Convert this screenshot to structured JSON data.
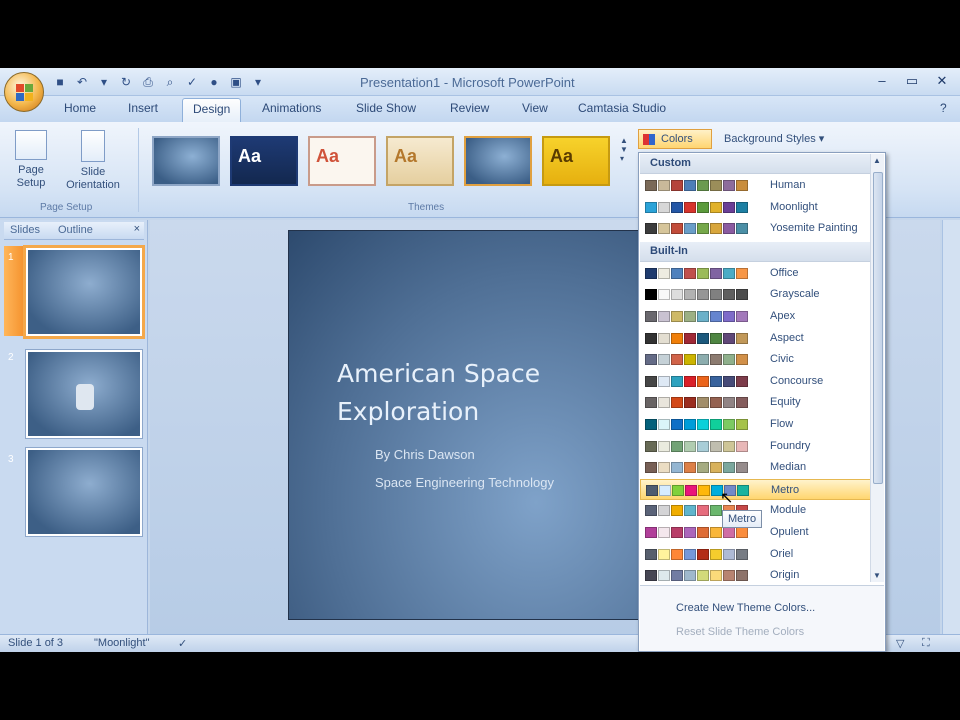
{
  "window": {
    "title": "Presentation1 - Microsoft PowerPoint",
    "controls": [
      "–",
      "▭",
      "✕"
    ]
  },
  "tabs": [
    "Home",
    "Insert",
    "Design",
    "Animations",
    "Slide Show",
    "Review",
    "View",
    "Camtasia Studio"
  ],
  "active_tab": "Design",
  "ribbon": {
    "page_setup": {
      "button1": "Page Setup",
      "button2": "Slide Orientation",
      "group": "Page Setup"
    },
    "themes": {
      "group": "Themes",
      "sample": "Aa"
    },
    "colors_button": "Colors",
    "background_styles": "Background Styles"
  },
  "slides_pane": {
    "tabs": [
      "Slides",
      "Outline"
    ],
    "numbers": [
      "1",
      "2",
      "3"
    ]
  },
  "slide": {
    "title_line1": "American Space",
    "title_line2": "Exploration",
    "subtitle1": "By Chris Dawson",
    "subtitle2": "Space Engineering Technology"
  },
  "statusbar": {
    "slide_info": "Slide 1 of 3",
    "theme": "\"Moonlight\""
  },
  "colors_menu": {
    "custom_header": "Custom",
    "builtin_header": "Built-In",
    "custom": [
      {
        "name": "Human",
        "colors": [
          "#7b6a58",
          "#c9b99a",
          "#b5443b",
          "#4d7eb8",
          "#6a9a4f",
          "#9b8e5a",
          "#8d6c9c",
          "#c98d3c"
        ]
      },
      {
        "name": "Moonlight",
        "colors": [
          "#2ba3d8",
          "#d7d7d7",
          "#2457a6",
          "#d6342c",
          "#5b9a3b",
          "#e1b22a",
          "#6a3f96",
          "#1d7fa3"
        ]
      },
      {
        "name": "Yosemite Painting",
        "colors": [
          "#3c3c3c",
          "#d6c59a",
          "#c24c3a",
          "#6a9ec8",
          "#76a84a",
          "#d8a63c",
          "#8a5ba0",
          "#4b8fa6"
        ]
      }
    ],
    "builtin": [
      {
        "name": "Office",
        "colors": [
          "#1f3b6e",
          "#eeece1",
          "#4f81bd",
          "#c0504d",
          "#9bbb59",
          "#8064a2",
          "#4bacc6",
          "#f79646"
        ]
      },
      {
        "name": "Grayscale",
        "colors": [
          "#000000",
          "#f8f8f8",
          "#dddddd",
          "#b2b2b2",
          "#969696",
          "#808080",
          "#5f5f5f",
          "#4d4d4d"
        ]
      },
      {
        "name": "Apex",
        "colors": [
          "#69676d",
          "#c9c2d1",
          "#ceb966",
          "#9cb084",
          "#6bb1c9",
          "#6585cf",
          "#7e6bc9",
          "#a379bb"
        ]
      },
      {
        "name": "Aspect",
        "colors": [
          "#323232",
          "#e3ded1",
          "#f07f09",
          "#9f2936",
          "#1b587c",
          "#4e8542",
          "#604878",
          "#c19859"
        ]
      },
      {
        "name": "Civic",
        "colors": [
          "#646b86",
          "#c5d1d7",
          "#d16349",
          "#ccb400",
          "#8cadae",
          "#8c7b70",
          "#8fb08c",
          "#d19049"
        ]
      },
      {
        "name": "Concourse",
        "colors": [
          "#464646",
          "#dee9f5",
          "#2da2bf",
          "#da1f28",
          "#eb641b",
          "#39639d",
          "#474b78",
          "#7d3c4a"
        ]
      },
      {
        "name": "Equity",
        "colors": [
          "#696464",
          "#e9e5dc",
          "#d34817",
          "#9b2d1f",
          "#a28e6a",
          "#956251",
          "#918485",
          "#855d5d"
        ]
      },
      {
        "name": "Flow",
        "colors": [
          "#04617b",
          "#dbf5f9",
          "#0f6fc6",
          "#009dd9",
          "#0bd0d9",
          "#10cf9b",
          "#7cca62",
          "#a5c249"
        ]
      },
      {
        "name": "Foundry",
        "colors": [
          "#676a55",
          "#eaebde",
          "#72a376",
          "#b0ccb0",
          "#a8cdd7",
          "#c0beaf",
          "#cec597",
          "#e8b7b7"
        ]
      },
      {
        "name": "Median",
        "colors": [
          "#775f55",
          "#ebddc3",
          "#94b6d2",
          "#dd8047",
          "#a5ab81",
          "#d8b25c",
          "#7ba79d",
          "#968c8c"
        ]
      },
      {
        "name": "Metro",
        "colors": [
          "#4e5b6f",
          "#d6ecff",
          "#7fd13b",
          "#ea157a",
          "#feb80a",
          "#00addc",
          "#738ac8",
          "#1ab39f"
        ]
      },
      {
        "name": "Module",
        "colors": [
          "#5a6378",
          "#d4d4d6",
          "#f0ad00",
          "#60b5cc",
          "#e66c7d",
          "#6bb76d",
          "#e88651",
          "#c64847"
        ]
      },
      {
        "name": "Opulent",
        "colors": [
          "#b13f9a",
          "#f4e7ed",
          "#b83d68",
          "#ac66bb",
          "#de6c36",
          "#f9b639",
          "#cf6da4",
          "#fa8d3d"
        ]
      },
      {
        "name": "Oriel",
        "colors": [
          "#575f6d",
          "#fff39d",
          "#fe8637",
          "#7598d9",
          "#b32c16",
          "#f5cd2d",
          "#aebad5",
          "#777c84"
        ]
      },
      {
        "name": "Origin",
        "colors": [
          "#464653",
          "#dde9ec",
          "#727ca3",
          "#9fb8cd",
          "#d2da7a",
          "#fada7a",
          "#b88472",
          "#8e736a"
        ]
      }
    ],
    "hover_item": "Metro",
    "tooltip": "Metro",
    "create_new": "Create New Theme Colors...",
    "reset": "Reset Slide Theme Colors"
  }
}
